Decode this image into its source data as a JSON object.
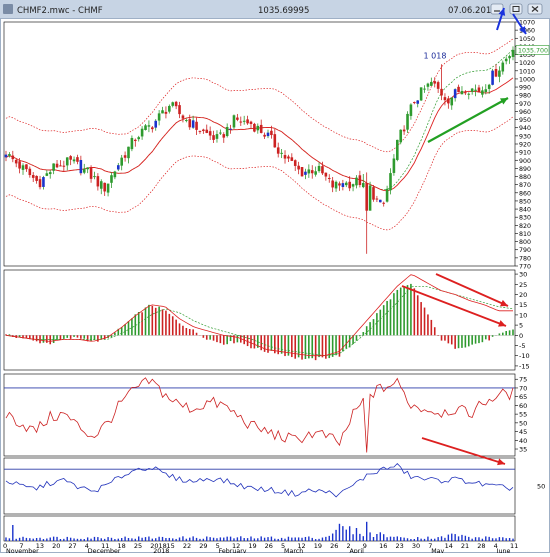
{
  "window": {
    "title": "CHMF2.mwc - CHMF",
    "last_price": "1035.69995",
    "date": "07.06.2018"
  },
  "colors": {
    "frame": "#9fb0c6",
    "titlebar": "#c7d4e4",
    "grid": "#c8c8c8",
    "up": "#2e9a2e",
    "down": "#cc2222",
    "mid_up": "#1a33cc",
    "bands": "#dd2222",
    "ma": "#dd2222",
    "signal": "#2e9a2e",
    "rsi": "#cc2222",
    "stoch": "#2233bb",
    "volume": "#1a33cc",
    "arrow_red": "#dd2020",
    "arrow_green": "#22a022",
    "arrow_blue": "#1a33dd",
    "price_tag": "#2e9a2e"
  },
  "chart_data": [
    {
      "type": "candlestick",
      "pane": "price",
      "ylim": [
        770,
        1070
      ],
      "y_ticks": [
        770,
        780,
        790,
        800,
        810,
        820,
        830,
        840,
        850,
        860,
        870,
        880,
        890,
        900,
        910,
        920,
        930,
        940,
        950,
        960,
        970,
        980,
        990,
        1000,
        1010,
        1020,
        1030,
        1040,
        1050,
        1060,
        1070
      ],
      "annotation": "1 018",
      "last_label": "1035.700",
      "candles_weekly_approx": [
        {
          "date": "2017-11-01",
          "open": 905,
          "high": 918,
          "low": 895,
          "close": 908
        },
        {
          "date": "2017-11-08",
          "open": 908,
          "high": 915,
          "low": 885,
          "close": 890
        },
        {
          "date": "2017-11-15",
          "open": 890,
          "high": 905,
          "low": 865,
          "close": 872
        },
        {
          "date": "2017-11-22",
          "open": 872,
          "high": 895,
          "low": 868,
          "close": 893
        },
        {
          "date": "2017-11-29",
          "open": 893,
          "high": 905,
          "low": 880,
          "close": 898
        },
        {
          "date": "2017-12-06",
          "open": 898,
          "high": 905,
          "low": 880,
          "close": 885
        },
        {
          "date": "2017-12-13",
          "open": 885,
          "high": 890,
          "low": 860,
          "close": 865
        },
        {
          "date": "2017-12-20",
          "open": 865,
          "high": 905,
          "low": 863,
          "close": 900
        },
        {
          "date": "2017-12-27",
          "open": 900,
          "high": 935,
          "low": 898,
          "close": 930
        },
        {
          "date": "2018-01-03",
          "open": 930,
          "high": 950,
          "low": 920,
          "close": 945
        },
        {
          "date": "2018-01-10",
          "open": 945,
          "high": 978,
          "low": 940,
          "close": 968
        },
        {
          "date": "2018-01-17",
          "open": 968,
          "high": 975,
          "low": 940,
          "close": 950
        },
        {
          "date": "2018-01-24",
          "open": 950,
          "high": 965,
          "low": 925,
          "close": 935
        },
        {
          "date": "2018-01-31",
          "open": 935,
          "high": 950,
          "low": 910,
          "close": 925
        },
        {
          "date": "2018-02-07",
          "open": 925,
          "high": 955,
          "low": 918,
          "close": 950
        },
        {
          "date": "2018-02-14",
          "open": 950,
          "high": 965,
          "low": 935,
          "close": 945
        },
        {
          "date": "2018-02-21",
          "open": 945,
          "high": 950,
          "low": 920,
          "close": 930
        },
        {
          "date": "2018-02-28",
          "open": 930,
          "high": 935,
          "low": 895,
          "close": 905
        },
        {
          "date": "2018-03-07",
          "open": 905,
          "high": 915,
          "low": 880,
          "close": 885
        },
        {
          "date": "2018-03-14",
          "open": 885,
          "high": 900,
          "low": 875,
          "close": 890
        },
        {
          "date": "2018-03-21",
          "open": 890,
          "high": 895,
          "low": 862,
          "close": 868
        },
        {
          "date": "2018-03-28",
          "open": 868,
          "high": 880,
          "low": 860,
          "close": 872
        },
        {
          "date": "2018-04-04",
          "open": 872,
          "high": 880,
          "low": 862,
          "close": 875
        },
        {
          "date": "2018-04-09",
          "open": 875,
          "high": 878,
          "low": 785,
          "close": 838
        },
        {
          "date": "2018-04-16",
          "open": 838,
          "high": 930,
          "low": 836,
          "close": 925
        },
        {
          "date": "2018-04-23",
          "open": 925,
          "high": 985,
          "low": 920,
          "close": 975
        },
        {
          "date": "2018-04-30",
          "open": 975,
          "high": 1018,
          "low": 970,
          "close": 995
        },
        {
          "date": "2018-05-07",
          "open": 995,
          "high": 1000,
          "low": 960,
          "close": 975
        },
        {
          "date": "2018-05-14",
          "open": 975,
          "high": 995,
          "low": 968,
          "close": 990
        },
        {
          "date": "2018-05-21",
          "open": 990,
          "high": 1005,
          "low": 975,
          "close": 985
        },
        {
          "date": "2018-05-28",
          "open": 985,
          "high": 1015,
          "low": 980,
          "close": 1010
        },
        {
          "date": "2018-06-04",
          "open": 1010,
          "high": 1040,
          "low": 1000,
          "close": 1035.7
        }
      ]
    },
    {
      "type": "bar",
      "pane": "macd_histogram",
      "ylim": [
        -17,
        32
      ],
      "y_ticks": [
        -15,
        -10,
        -5,
        0,
        5,
        10,
        15,
        20,
        25,
        30
      ],
      "series_weekly_approx": [
        {
          "name": "histogram",
          "values": [
            0,
            -1,
            -3,
            -4,
            -2,
            -1,
            -3,
            -2,
            4,
            10,
            15,
            12,
            6,
            2,
            -2,
            -4,
            -3,
            -6,
            -8,
            -9,
            -11,
            -12,
            -11,
            -10,
            -4,
            5,
            14,
            22,
            25,
            12,
            -2,
            -6,
            -5,
            -3,
            0,
            3
          ]
        },
        {
          "name": "macd",
          "values": [
            0,
            -1,
            -2,
            -3,
            -2,
            -2,
            -3,
            -1,
            4,
            10,
            15,
            14,
            8,
            4,
            2,
            0,
            -1,
            -4,
            -7,
            -8,
            -9,
            -10,
            -10,
            -8,
            0,
            8,
            16,
            24,
            30,
            26,
            22,
            20,
            17,
            15,
            12,
            12
          ]
        },
        {
          "name": "signal",
          "values": [
            0,
            -1,
            -2,
            -2,
            -2,
            -2,
            -2,
            -2,
            1,
            5,
            10,
            13,
            11,
            7,
            4,
            2,
            0,
            -2,
            -5,
            -7,
            -8,
            -9,
            -10,
            -9,
            -4,
            2,
            9,
            16,
            24,
            24,
            22,
            20,
            18,
            16,
            14,
            13
          ]
        }
      ]
    },
    {
      "type": "line",
      "pane": "rsi",
      "ylim": [
        31,
        78
      ],
      "y_ticks": [
        35,
        40,
        45,
        50,
        55,
        60,
        65,
        70,
        75
      ],
      "levels": [
        70
      ],
      "series_weekly_approx": [
        {
          "name": "rsi",
          "values": [
            55,
            50,
            45,
            53,
            55,
            48,
            42,
            50,
            62,
            70,
            74,
            66,
            60,
            58,
            62,
            60,
            54,
            48,
            45,
            42,
            40,
            44,
            43,
            38,
            55,
            66,
            70,
            73,
            60,
            58,
            56,
            58,
            55,
            62,
            66,
            67
          ]
        }
      ]
    },
    {
      "type": "line",
      "pane": "stochastic",
      "ylim": [
        0,
        100
      ],
      "y_ticks": [
        50
      ],
      "series_weekly_approx": [
        {
          "name": "stoch",
          "values": [
            60,
            50,
            45,
            55,
            60,
            48,
            40,
            52,
            68,
            80,
            84,
            70,
            62,
            58,
            64,
            60,
            52,
            46,
            44,
            40,
            36,
            42,
            40,
            34,
            52,
            70,
            80,
            86,
            66,
            62,
            60,
            62,
            58,
            52,
            48,
            46
          ]
        }
      ]
    },
    {
      "type": "bar",
      "pane": "volume",
      "x_tick_labels": [
        "0",
        "7",
        "13",
        "20",
        "27",
        "4",
        "11",
        "18",
        "25",
        "2018",
        "15",
        "22",
        "29",
        "5",
        "12",
        "19",
        "26",
        "5",
        "12",
        "19",
        "26",
        "2",
        "9",
        "16",
        "23",
        "30",
        "7",
        "14",
        "21",
        "28",
        "4",
        "11"
      ],
      "month_labels": [
        "November",
        "December",
        "2018",
        "February",
        "March",
        "April",
        "May",
        "June"
      ],
      "series_weekly_approx": [
        {
          "name": "volume",
          "values": [
            1,
            1,
            1,
            1,
            1,
            1,
            1,
            1,
            1,
            1,
            1,
            1,
            1,
            1,
            1,
            1,
            1,
            1,
            1,
            1,
            1,
            1,
            1,
            4,
            3,
            2,
            2,
            1,
            1,
            1,
            1,
            2,
            1,
            1,
            1,
            1
          ]
        }
      ]
    }
  ]
}
